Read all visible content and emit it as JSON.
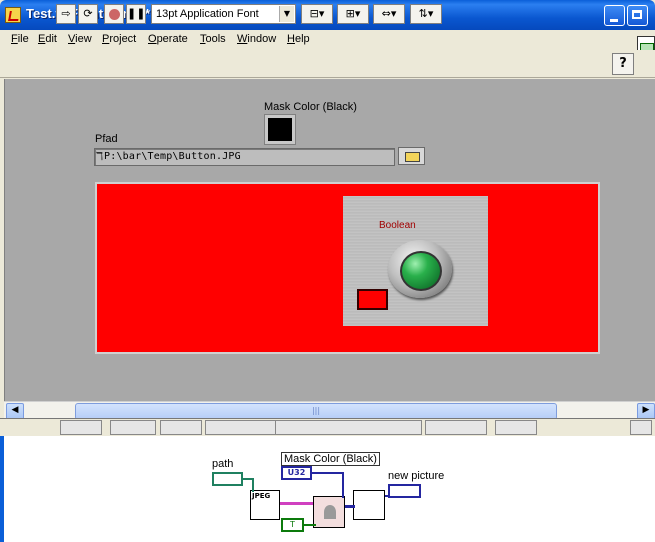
{
  "window": {
    "title": "Test.vi Front Panel *"
  },
  "menu": [
    {
      "label": "File",
      "ul": "F",
      "rest": "ile"
    },
    {
      "label": "Edit",
      "ul": "E",
      "rest": "dit"
    },
    {
      "label": "View",
      "ul": "V",
      "rest": "iew"
    },
    {
      "label": "Project",
      "ul": "P",
      "rest": "roject"
    },
    {
      "label": "Operate",
      "ul": "O",
      "rest": "perate"
    },
    {
      "label": "Tools",
      "ul": "T",
      "rest": "ools"
    },
    {
      "label": "Window",
      "ul": "W",
      "rest": "indow"
    },
    {
      "label": "Help",
      "ul": "H",
      "rest": "elp"
    }
  ],
  "toolbar": {
    "font": "13pt Application Font",
    "help": "?",
    "icons": [
      "run-arrow-icon",
      "run-continuous-icon",
      "abort-icon",
      "pause-icon",
      "align-icon",
      "distribute-icon",
      "resize-icon",
      "reorder-icon"
    ]
  },
  "front_panel": {
    "mask_label": "Mask Color (Black)",
    "mask_color": "#000000",
    "path_label": "Pfad",
    "path_value": "P:\\bar\\Temp\\Button.JPG",
    "boolean_label": "Boolean",
    "picture_bg": "#ff0000"
  },
  "block_diagram": {
    "path_label": "path",
    "mask_label": "Mask Color (Black)",
    "mask_type": "U32",
    "newpic_label": "new picture",
    "jpeg_label": "JPEG",
    "bool_const": "T"
  }
}
